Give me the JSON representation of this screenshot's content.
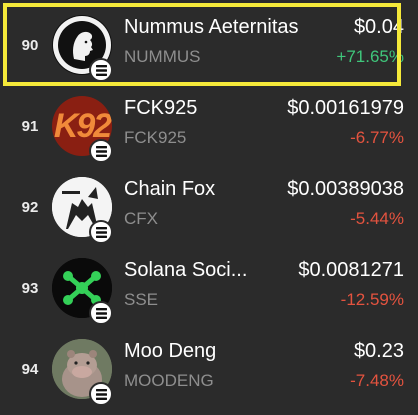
{
  "colors": {
    "background": "#2b2b2b",
    "positive": "#3fc67b",
    "negative": "#e4533f",
    "muted": "#8e8e8e",
    "highlight": "#f5e93a"
  },
  "tokens": [
    {
      "rank": "90",
      "name": "Nummus Aeternitas",
      "ticker": "NUMMUS",
      "price": "$0.04",
      "change": "+71.65%",
      "direction": "up",
      "avatar_icon": "roman-coin-head-icon",
      "chain_icon": "solana-icon",
      "highlighted": true
    },
    {
      "rank": "91",
      "name": "FCK925",
      "ticker": "FCK925",
      "price": "$0.00161979",
      "change": "-6.77%",
      "direction": "down",
      "avatar_icon": "k92-logo-icon",
      "avatar_text": "K92",
      "chain_icon": "solana-icon"
    },
    {
      "rank": "92",
      "name": "Chain Fox",
      "ticker": "CFX",
      "price": "$0.00389038",
      "change": "-5.44%",
      "direction": "down",
      "avatar_icon": "chain-fox-sketch-icon",
      "chain_icon": "solana-icon"
    },
    {
      "rank": "93",
      "name": "Solana Soci...",
      "ticker": "SSE",
      "price": "$0.0081271",
      "change": "-12.59%",
      "direction": "down",
      "avatar_icon": "network-nodes-icon",
      "chain_icon": "solana-icon"
    },
    {
      "rank": "94",
      "name": "Moo Deng",
      "ticker": "MOODENG",
      "price": "$0.23",
      "change": "-7.48%",
      "direction": "down",
      "avatar_icon": "baby-hippo-photo-icon",
      "chain_icon": "solana-icon"
    }
  ]
}
